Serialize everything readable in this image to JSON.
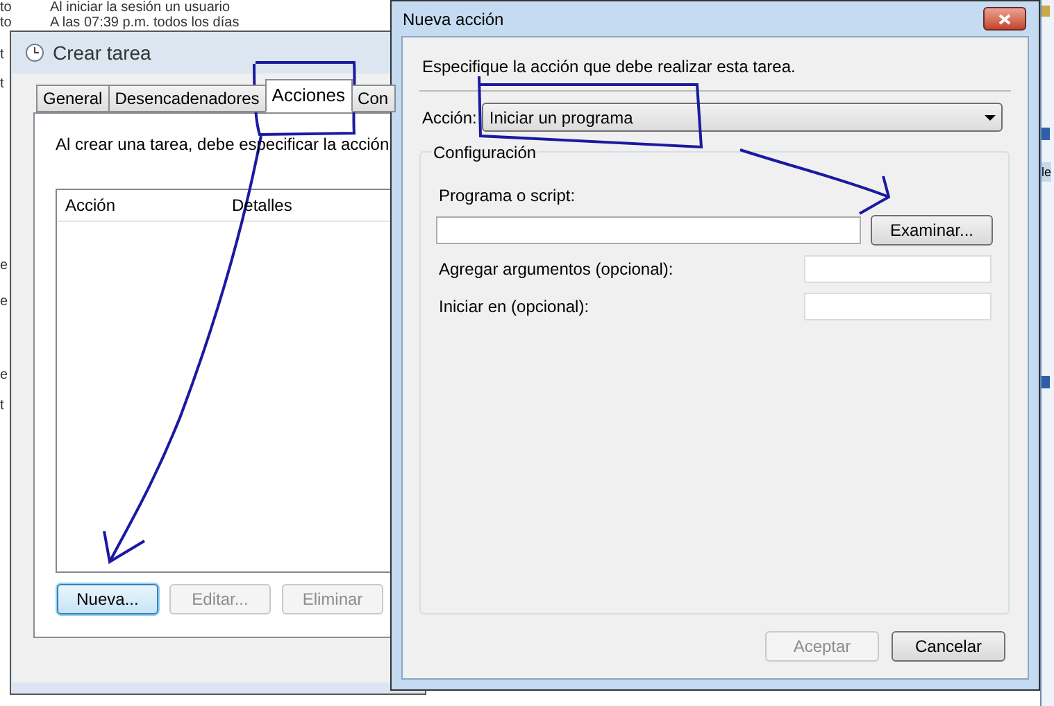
{
  "background_list": {
    "rows": [
      {
        "column_1": "to",
        "column_2": "Al iniciar la sesión un usuario"
      },
      {
        "column_1": "to",
        "column_2": "A las 07:39 p.m. todos los días"
      }
    ],
    "edge_fragments": [
      "t",
      "t",
      "e",
      "e",
      "e",
      "t"
    ]
  },
  "create_task_window": {
    "title": "Crear tarea",
    "tabs": [
      {
        "label": "General",
        "selected": false
      },
      {
        "label": "Desencadenadores",
        "selected": false
      },
      {
        "label": "Acciones",
        "selected": true
      },
      {
        "label": "Con",
        "selected": false
      }
    ],
    "description": "Al crear una tarea, debe especificar la acción",
    "table": {
      "columns": [
        "Acción",
        "Detalles"
      ]
    },
    "buttons": [
      {
        "label": "Nueva...",
        "disabled": false,
        "default": true
      },
      {
        "label": "Editar...",
        "disabled": true,
        "default": false
      },
      {
        "label": "Eliminar",
        "disabled": true,
        "default": false
      }
    ]
  },
  "new_action_dialog": {
    "title": "Nueva acción",
    "instruction": "Especifique la acción que debe realizar esta tarea.",
    "action": {
      "label": "Acción:",
      "value": "Iniciar un programa"
    },
    "settings": {
      "title": "Configuración",
      "program": {
        "label": "Programa o script:",
        "browse_button": "Examinar..."
      },
      "fields": [
        {
          "label": "Agregar argumentos (opcional):"
        },
        {
          "label": "Iniciar en (opcional):"
        }
      ]
    },
    "buttons": [
      {
        "label": "Aceptar",
        "disabled": true
      },
      {
        "label": "Cancelar",
        "disabled": false
      }
    ]
  },
  "side_panel": {
    "fragment": "le"
  }
}
